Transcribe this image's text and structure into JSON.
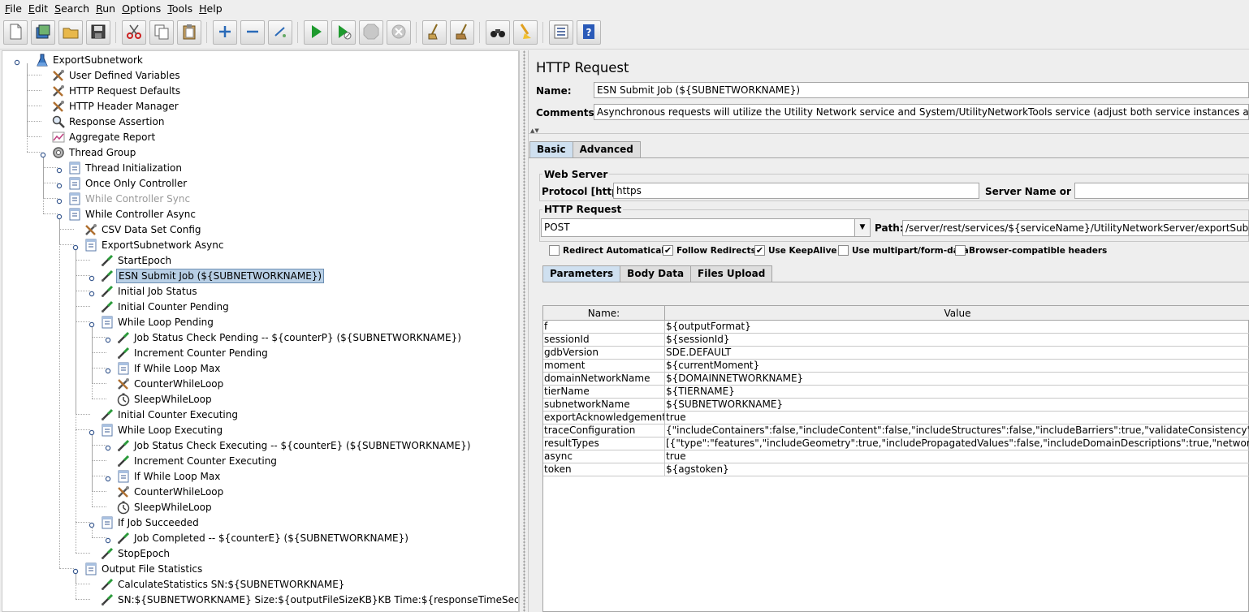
{
  "menubar": {
    "items": [
      {
        "label": "File",
        "key": "F"
      },
      {
        "label": "Edit",
        "key": "E"
      },
      {
        "label": "Search",
        "key": "S"
      },
      {
        "label": "Run",
        "key": "R"
      },
      {
        "label": "Options",
        "key": "O"
      },
      {
        "label": "Tools",
        "key": "T"
      },
      {
        "label": "Help",
        "key": "H"
      }
    ]
  },
  "toolbar": {
    "buttons": [
      "new-icon",
      "templates-icon",
      "open-icon",
      "save-icon",
      "cut-icon",
      "copy-icon",
      "paste-icon",
      "expand-icon",
      "collapse-icon",
      "toggle-icon",
      "start-icon",
      "start-no-pause-icon",
      "stop-icon",
      "shutdown-icon",
      "clear-icon",
      "clear-all-icon",
      "search-icon",
      "reset-search-icon",
      "function-helper-icon",
      "help-icon"
    ]
  },
  "tree": {
    "nodes": [
      {
        "label": "ExportSubnetwork",
        "icon": "test-plan-icon"
      },
      {
        "label": "User Defined Variables",
        "icon": "config-icon"
      },
      {
        "label": "HTTP Request Defaults",
        "icon": "config-icon"
      },
      {
        "label": "HTTP Header Manager",
        "icon": "config-icon"
      },
      {
        "label": "Response Assertion",
        "icon": "assertion-icon"
      },
      {
        "label": "Aggregate Report",
        "icon": "listener-icon"
      },
      {
        "label": "Thread Group",
        "icon": "thread-group-icon"
      },
      {
        "label": "Thread Initialization",
        "icon": "controller-icon"
      },
      {
        "label": "Once Only Controller",
        "icon": "controller-icon"
      },
      {
        "label": "While Controller Sync",
        "icon": "controller-icon"
      },
      {
        "label": "While Controller Async",
        "icon": "controller-icon"
      },
      {
        "label": "CSV Data Set Config",
        "icon": "config-icon"
      },
      {
        "label": "ExportSubnetwork Async",
        "icon": "controller-icon"
      },
      {
        "label": "StartEpoch",
        "icon": "sampler-icon"
      },
      {
        "label": "ESN Submit Job (${SUBNETWORKNAME})",
        "icon": "sampler-icon"
      },
      {
        "label": "Initial Job Status",
        "icon": "sampler-icon"
      },
      {
        "label": "Initial Counter Pending",
        "icon": "sampler-icon"
      },
      {
        "label": "While Loop Pending",
        "icon": "controller-icon"
      },
      {
        "label": "Job Status Check Pending -- ${counterP} (${SUBNETWORKNAME})",
        "icon": "sampler-icon"
      },
      {
        "label": "Increment Counter Pending",
        "icon": "sampler-icon"
      },
      {
        "label": "If While Loop Max",
        "icon": "controller-icon"
      },
      {
        "label": "CounterWhileLoop",
        "icon": "config-icon"
      },
      {
        "label": "SleepWhileLoop",
        "icon": "timer-icon"
      },
      {
        "label": "Initial Counter Executing",
        "icon": "sampler-icon"
      },
      {
        "label": "While Loop Executing",
        "icon": "controller-icon"
      },
      {
        "label": "Job Status Check Executing -- ${counterE} (${SUBNETWORKNAME})",
        "icon": "sampler-icon"
      },
      {
        "label": "Increment Counter Executing",
        "icon": "sampler-icon"
      },
      {
        "label": "If While Loop Max",
        "icon": "controller-icon"
      },
      {
        "label": "CounterWhileLoop",
        "icon": "config-icon"
      },
      {
        "label": "SleepWhileLoop",
        "icon": "timer-icon"
      },
      {
        "label": "If Job Succeeded",
        "icon": "controller-icon"
      },
      {
        "label": "Job Completed -- ${counterE} (${SUBNETWORKNAME})",
        "icon": "sampler-icon"
      },
      {
        "label": "StopEpoch",
        "icon": "sampler-icon"
      },
      {
        "label": "Output File Statistics",
        "icon": "controller-icon"
      },
      {
        "label": "CalculateStatistics SN:${SUBNETWORKNAME}",
        "icon": "sampler-icon"
      },
      {
        "label": "SN:${SUBNETWORKNAME} Size:${outputFileSizeKB}KB Time:${responseTimeSec}seconds",
        "icon": "sampler-icon"
      }
    ]
  },
  "panel": {
    "title": "HTTP Request",
    "name_label": "Name:",
    "name_value": "ESN Submit Job (${SUBNETWORKNAME})",
    "comments_label": "Comments:",
    "comments_value": "Asynchronous requests will utilize the Utility Network service and System/UtilityNetworkTools service (adjust both service instances accordingly)",
    "tabs": [
      "Basic",
      "Advanced"
    ],
    "web_server": {
      "title": "Web Server",
      "protocol_label": "Protocol [http]:",
      "protocol_value": "https",
      "server_label": "Server Name or IP:",
      "server_value": ""
    },
    "http_request": {
      "title": "HTTP Request",
      "method": "POST",
      "path_label": "Path:",
      "path_value": "/server/rest/services/${serviceName}/UtilityNetworkServer/exportSubnetwork"
    },
    "checkboxes": [
      {
        "label": "Redirect Automatically",
        "checked": false
      },
      {
        "label": "Follow Redirects",
        "checked": true
      },
      {
        "label": "Use KeepAlive",
        "checked": true
      },
      {
        "label": "Use multipart/form-data",
        "checked": false
      },
      {
        "label": "Browser-compatible headers",
        "checked": false
      }
    ],
    "subtabs": [
      "Parameters",
      "Body Data",
      "Files Upload"
    ],
    "table": {
      "headers": [
        "Name:",
        "Value"
      ],
      "rows": [
        [
          "f",
          "${outputFormat}"
        ],
        [
          "sessionId",
          "${sessionId}"
        ],
        [
          "gdbVersion",
          "SDE.DEFAULT"
        ],
        [
          "moment",
          "${currentMoment}"
        ],
        [
          "domainNetworkName",
          "${DOMAINNETWORKNAME}"
        ],
        [
          "tierName",
          "${TIERNAME}"
        ],
        [
          "subnetworkName",
          "${SUBNETWORKNAME}"
        ],
        [
          "exportAcknowledgement",
          "true"
        ],
        [
          "traceConfiguration",
          "{\"includeContainers\":false,\"includeContent\":false,\"includeStructures\":false,\"includeBarriers\":true,\"validateConsistency\":true,\"validate"
        ],
        [
          "resultTypes",
          "[{\"type\":\"features\",\"includeGeometry\":true,\"includePropagatedValues\":false,\"includeDomainDescriptions\":true,\"networkAttributeName"
        ],
        [
          "async",
          "true"
        ],
        [
          "token",
          "${agstoken}"
        ]
      ]
    }
  }
}
